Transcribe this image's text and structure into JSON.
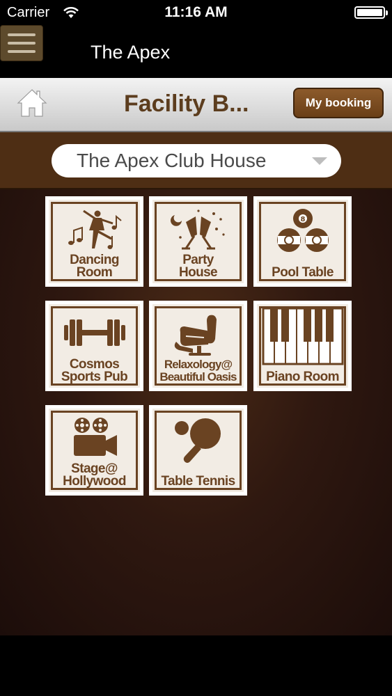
{
  "status_bar": {
    "carrier": "Carrier",
    "time": "11:16 AM"
  },
  "nav": {
    "title": "The Apex",
    "menu_icon": "hamburger-menu-icon"
  },
  "header": {
    "title": "Facility B...",
    "home_icon": "home-icon",
    "my_booking_label": "My booking"
  },
  "club_selector": {
    "selected": "The Apex Club House"
  },
  "facilities": [
    {
      "label": "Dancing\nRoom",
      "icon": "dancer-icon"
    },
    {
      "label": "Party\nHouse",
      "icon": "champagne-toast-icon"
    },
    {
      "label": "Pool Table",
      "icon": "billiard-balls-icon"
    },
    {
      "label": "Cosmos\nSports Pub",
      "icon": "dumbbell-icon"
    },
    {
      "label": "Relaxology@\nBeautiful Oasis",
      "icon": "massage-chair-icon"
    },
    {
      "label": "Piano Room",
      "icon": "piano-keys-icon"
    },
    {
      "label": "Stage@\nHollywood",
      "icon": "movie-camera-icon"
    },
    {
      "label": "Table Tennis",
      "icon": "ping-pong-icon"
    }
  ],
  "colors": {
    "brand_brown": "#6a4322",
    "header_bar": "#4e2e14",
    "button": "#7a4b20"
  }
}
